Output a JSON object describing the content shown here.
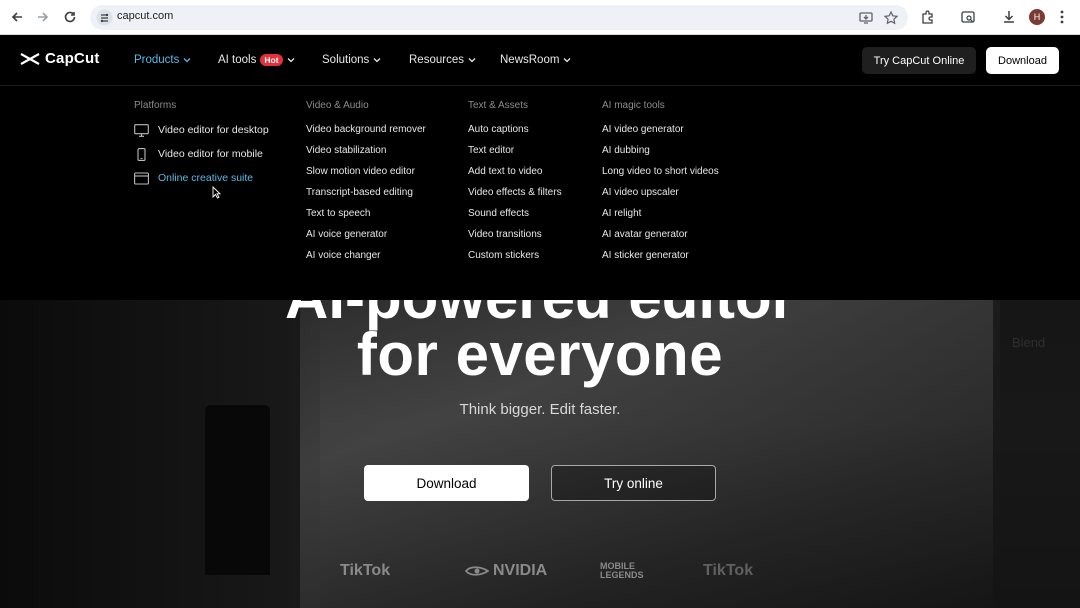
{
  "browser": {
    "url": "capcut.com",
    "profile_initial": "H",
    "icons": [
      "back-arrow-icon",
      "forward-arrow-icon",
      "reload-icon",
      "site-settings-icon",
      "install-app-icon",
      "star-icon",
      "extensions-icon",
      "tab-search-icon",
      "download-icon",
      "more-menu-icon"
    ]
  },
  "header": {
    "brand": "CapCut",
    "nav": [
      {
        "label": "Products",
        "active": true
      },
      {
        "label": "AI tools",
        "badge": "Hot"
      },
      {
        "label": "Solutions"
      },
      {
        "label": "Resources"
      },
      {
        "label": "NewsRoom"
      }
    ],
    "try_online": "Try CapCut Online",
    "download": "Download"
  },
  "dropdown": {
    "platforms": {
      "title": "Platforms",
      "items": [
        {
          "label": "Video editor for desktop",
          "icon": "desktop-icon"
        },
        {
          "label": "Video editor for mobile",
          "icon": "mobile-icon"
        },
        {
          "label": "Online creative suite",
          "icon": "browser-window-icon",
          "hover": true
        }
      ]
    },
    "video_audio": {
      "title": "Video & Audio",
      "items": [
        "Video background remover",
        "Video stabilization",
        "Slow motion video editor",
        "Transcript-based editing",
        "Text to speech",
        "AI voice generator",
        "AI voice changer"
      ]
    },
    "text_assets": {
      "title": "Text & Assets",
      "items": [
        "Auto captions",
        "Text editor",
        "Add text to video",
        "Video effects & filters",
        "Sound effects",
        "Video transitions",
        "Custom stickers"
      ]
    },
    "ai_magic": {
      "title": "AI magic tools",
      "items": [
        "AI video generator",
        "AI dubbing",
        "Long video to short videos",
        "AI video upscaler",
        "AI relight",
        "AI avatar generator",
        "AI sticker generator"
      ]
    }
  },
  "hero": {
    "title_top": "AI-powered editor",
    "title": "for everyone",
    "subtitle": "Think bigger. Edit faster.",
    "download": "Download",
    "try_online": "Try online",
    "background_label": "Blend",
    "partners": [
      "TikTok",
      "NVIDIA",
      "MOBILE LEGENDS",
      "TikTok"
    ]
  },
  "colors": {
    "accent": "#5cb8e6",
    "hot_badge": "#e5303a",
    "background": "#000000"
  }
}
